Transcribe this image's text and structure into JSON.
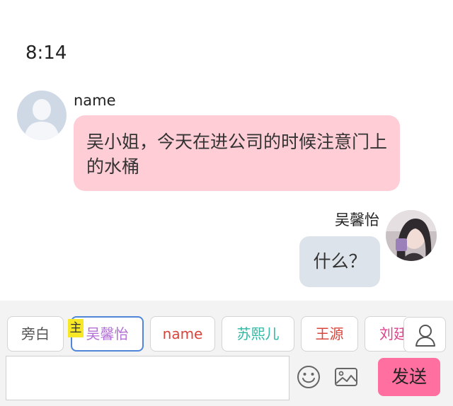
{
  "status": {
    "time": "8:14"
  },
  "messages": [
    {
      "sender": "name",
      "text": "吴小姐，今天在进公司的时候注意门上的水桶",
      "avatar": "default-user-icon",
      "side": "left",
      "bubble_color": "#ffcdd6"
    },
    {
      "sender": "吴馨怡",
      "text": "什么？",
      "avatar": "profile-photo",
      "side": "right",
      "bubble_color": "#dde3ea"
    }
  ],
  "roles": {
    "items": [
      {
        "label": "旁白",
        "color": "#555555"
      },
      {
        "label": "吴馨怡",
        "color": "#b36fd6",
        "selected": true
      },
      {
        "label": "name",
        "color": "#d9453b"
      },
      {
        "label": "苏熙儿",
        "color": "#2fb8a4"
      },
      {
        "label": "王源",
        "color": "#d9453b"
      },
      {
        "label": "刘廷",
        "color": "#e0408c"
      }
    ],
    "main_tag": "主",
    "main_tag_color": "#f7e827",
    "selected_border_color": "#4f86d8",
    "person_icon": "person-icon"
  },
  "composer": {
    "input_value": "",
    "emoji_icon": "emoji-icon",
    "image_icon": "image-icon",
    "send_label": "发送",
    "send_color": "#ff6f9f"
  }
}
